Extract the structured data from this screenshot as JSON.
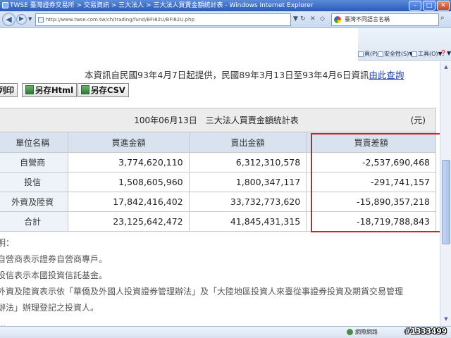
{
  "window": {
    "title": "TWSE 臺灣證券交易所 > 交易資訊 > 三大法人 > 三大法人買賣金額統計表 - Windows Internet Explorer",
    "buttons": {
      "minimize": "–",
      "maximize": "□",
      "close": "✕"
    }
  },
  "address_bar": {
    "url": "http://www.twse.com.tw/ch/trading/fund/BFI82U/BFI82U.php",
    "search_text": "臺灣不同語言名稱"
  },
  "command_bar": {
    "items": [
      {
        "label": "頁(P)▼",
        "icon": "page-icon"
      },
      {
        "label": "安全性(S)▼",
        "icon": "security-icon"
      },
      {
        "label": "工具(O)▼",
        "icon": "tools-icon"
      },
      {
        "label": "❓▼",
        "icon": "help-icon"
      }
    ]
  },
  "page": {
    "info_text": "本資訊自民國93年4月7日起提供，民國89年3月13日至93年4月6日資訊",
    "info_link": "由此查詢",
    "buttons": {
      "print": "列印",
      "save_html": "另存Html",
      "save_csv": "另存CSV"
    },
    "table": {
      "caption": "100年06月13日　三大法人買賣金額統計表",
      "unit": "(元)",
      "headers": [
        "單位名稱",
        "買進金額",
        "賣出金額",
        "買賣差額"
      ],
      "rows": [
        {
          "name": "自營商",
          "buy": "3,774,620,110",
          "sell": "6,312,310,578",
          "diff": "-2,537,690,468"
        },
        {
          "name": "投信",
          "buy": "1,508,605,960",
          "sell": "1,800,347,117",
          "diff": "-291,741,157"
        },
        {
          "name": "外資及陸資",
          "buy": "17,842,416,402",
          "sell": "33,732,773,620",
          "diff": "-15,890,357,218"
        },
        {
          "name": "合計",
          "buy": "23,125,642,472",
          "sell": "41,845,431,315",
          "diff": "-18,719,788,843"
        }
      ]
    },
    "notes": [
      "明：",
      "自營商表示證券自營商專戶。",
      "投信表示本國投資信託基金。",
      "外資及陸資表示依「華僑及外國人投資證券管理辦法」及「大陸地區投資人來臺從事證券投資及期貨交易管理",
      "辦法」辦理登記之投資人。",
      "…"
    ]
  },
  "status_bar": {
    "zone": "網際網路"
  },
  "watermark": "#1333499",
  "colors": {
    "highlight_border": "#d42020",
    "header_bg": "#d9e3ef",
    "link": "#1a3fa0"
  }
}
